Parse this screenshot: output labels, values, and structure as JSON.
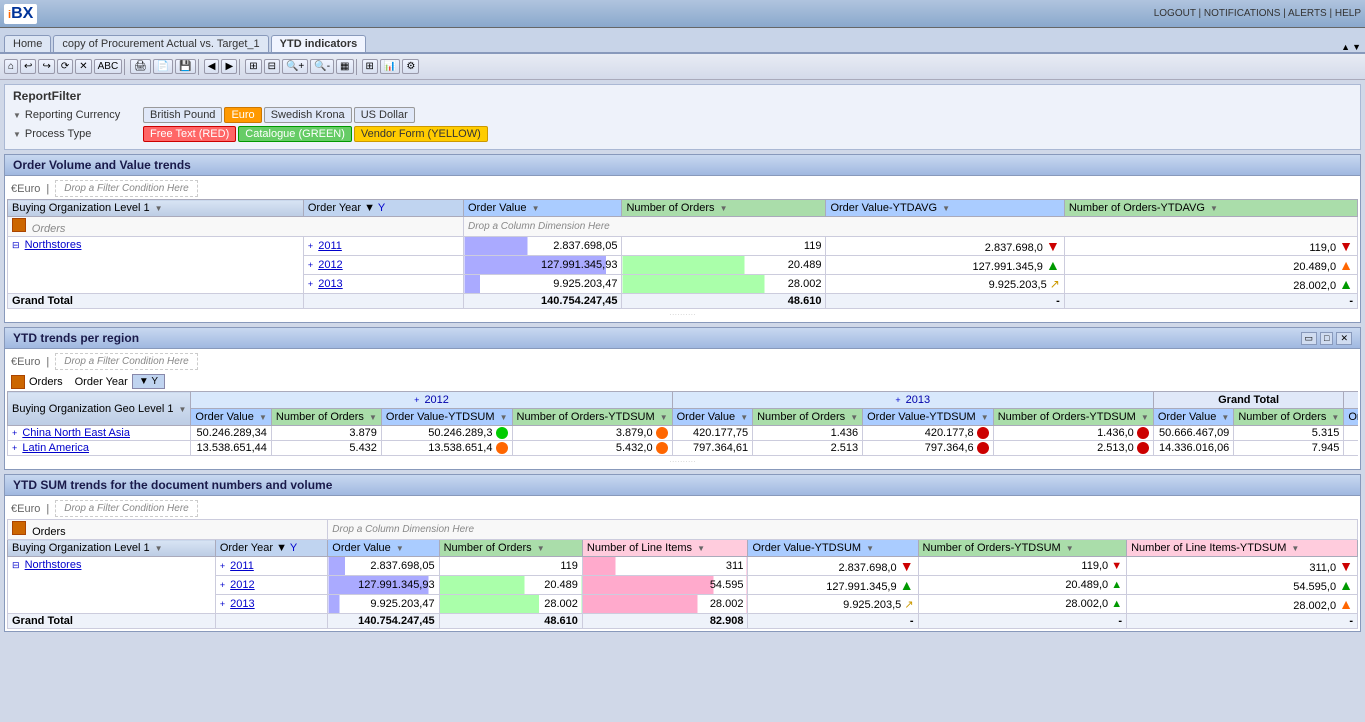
{
  "app": {
    "logo": "iBX",
    "top_right": "LOGOUT | NOTIFICATIONS | ALERTS | HELP"
  },
  "tabs": [
    {
      "label": "Home",
      "active": false
    },
    {
      "label": "copy of Procurement Actual vs. Target_1",
      "active": false
    },
    {
      "label": "YTD indicators",
      "active": true
    }
  ],
  "report_filter": {
    "title": "ReportFilter",
    "reporting_currency": {
      "label": "Reporting Currency",
      "options": [
        {
          "label": "British Pound",
          "active": false
        },
        {
          "label": "Euro",
          "active": true
        },
        {
          "label": "Swedish Krona",
          "active": false
        },
        {
          "label": "US Dollar",
          "active": false
        }
      ]
    },
    "process_type": {
      "label": "Process Type",
      "options": [
        {
          "label": "Free Text (RED)",
          "type": "red"
        },
        {
          "label": "Catalogue (GREEN)",
          "type": "green"
        },
        {
          "label": "Vendor Form (YELLOW)",
          "type": "yellow"
        }
      ]
    }
  },
  "section1": {
    "title": "Order Volume and Value trends",
    "currency_label": "€Euro",
    "drop_label": "Drop a Filter Condition Here",
    "orders_label": "Orders",
    "drop_col_label": "Drop a Column Dimension Here",
    "col_headers": [
      "Buying Organization Level 1",
      "Order Year",
      "Order Value",
      "Number of Orders",
      "Order Value-YTDAVG",
      "Number of Orders-YTDAVG"
    ],
    "rows": {
      "northstores": {
        "label": "Northstores",
        "years": [
          {
            "year": "2011",
            "order_value": "2.837.698,05",
            "num_orders": "119",
            "ytdavg_value": "2.837.698,0",
            "ytdavg_orders": "119,0",
            "arrow_orders": "down-red",
            "arrow_ytdavg": "down-red"
          },
          {
            "year": "2012",
            "order_value": "127.991.345,93",
            "num_orders": "20.489",
            "ytdavg_value": "127.991.345,9",
            "ytdavg_orders": "20.489,0",
            "arrow_orders": "up-green",
            "arrow_ytdavg": "up-orange"
          },
          {
            "year": "2013",
            "order_value": "9.925.203,47",
            "num_orders": "28.002",
            "ytdavg_value": "9.925.203,5",
            "ytdavg_orders": "28.002,0",
            "arrow_orders": "diag-green",
            "arrow_ytdavg": "up-green"
          }
        ]
      },
      "grand_total": {
        "label": "Grand Total",
        "order_value": "140.754.247,45",
        "num_orders": "48.610",
        "ytdavg_value": "-",
        "ytdavg_orders": "-"
      }
    }
  },
  "section2": {
    "title": "YTD trends per region",
    "currency_label": "€Euro",
    "drop_label": "Drop a Filter Condition Here",
    "orders_label": "Orders",
    "col_headers": [
      "Buying Organization Geo Level 1",
      "Order Value",
      "Number of Orders",
      "Order Value-YTDSUM",
      "Number of Orders-YTDSUM",
      "Order Value",
      "Number of Orders",
      "Order Value-YTDSUM",
      "Number of Orders-YTDSUM",
      "Order Value",
      "Number of Orders",
      "Order"
    ],
    "year_groups": [
      "2012",
      "2013",
      "Grand Total"
    ],
    "rows": [
      {
        "label": "China North East Asia",
        "y2012_order_value": "50.246.289,34",
        "y2012_num_orders": "3.879",
        "y2012_ytdsum_value": "50.246.289,3",
        "y2012_ytdsum_orders": "3.879,0",
        "y2012_circle": "green",
        "y2012_circle2": "orange",
        "y2013_order_value": "420.177,75",
        "y2013_num_orders": "1.436",
        "y2013_ytdsum_value": "420.177,8",
        "y2013_ytdsum_orders": "1.436,0",
        "y2013_circle": "red",
        "y2013_circle2": "red",
        "gt_order_value": "50.666.467,09",
        "gt_num_orders": "5.315"
      },
      {
        "label": "Latin America",
        "y2012_order_value": "13.538.651,44",
        "y2012_num_orders": "5.432",
        "y2012_ytdsum_value": "13.538.651,4",
        "y2012_ytdsum_orders": "5.432,0",
        "y2012_circle": "orange",
        "y2012_circle2": "orange",
        "y2013_order_value": "797.364,61",
        "y2013_num_orders": "2.513",
        "y2013_ytdsum_value": "797.364,6",
        "y2013_ytdsum_orders": "2.513,0",
        "y2013_circle": "red",
        "y2013_circle2": "red",
        "gt_order_value": "14.336.016,06",
        "gt_num_orders": "7.945"
      }
    ]
  },
  "section3": {
    "title": "YTD SUM trends for the document numbers and volume",
    "currency_label": "€Euro",
    "drop_label": "Drop a Filter Condition Here",
    "orders_label": "Orders",
    "drop_col_label": "Drop a Column Dimension Here",
    "col_headers": [
      "Buying Organization Level 1",
      "Order Year",
      "Order Value",
      "Number of Orders",
      "Number of Line Items",
      "Order Value-YTDSUM",
      "Number of Orders-YTDSUM",
      "Number of Line Items-YTDSUM"
    ],
    "rows": {
      "northstores": {
        "label": "Northstores",
        "years": [
          {
            "year": "2011",
            "order_value": "2.837.698,05",
            "num_orders": "119",
            "num_line_items": "311",
            "ytdsum_value": "2.837.698,0",
            "ytdsum_orders": "119,0",
            "ytdsum_items": "311,0",
            "arrow_ytdsum": "down-red",
            "arrow_orders": "down-red",
            "arrow_items": "down-red"
          },
          {
            "year": "2012",
            "order_value": "127.991.345,93",
            "num_orders": "20.489",
            "num_line_items": "54.595",
            "ytdsum_value": "127.991.345,9",
            "ytdsum_orders": "20.489,0",
            "ytdsum_items": "54.595,0",
            "arrow_ytdsum": "up-green",
            "arrow_orders": "up-green",
            "arrow_items": "up-green"
          },
          {
            "year": "2013",
            "order_value": "9.925.203,47",
            "num_orders": "28.002",
            "num_line_items": "28.002",
            "ytdsum_value": "9.925.203,5",
            "ytdsum_orders": "28.002,0",
            "ytdsum_items": "28.002,0",
            "arrow_ytdsum": "diag-green",
            "arrow_orders": "up-green",
            "arrow_items": "up-green"
          }
        ]
      },
      "grand_total": {
        "label": "Grand Total",
        "order_value": "140.754.247,45",
        "num_orders": "48.610",
        "num_line_items": "82.908",
        "ytdsum_value": "-",
        "ytdsum_orders": "-",
        "ytdsum_items": "-"
      }
    }
  }
}
